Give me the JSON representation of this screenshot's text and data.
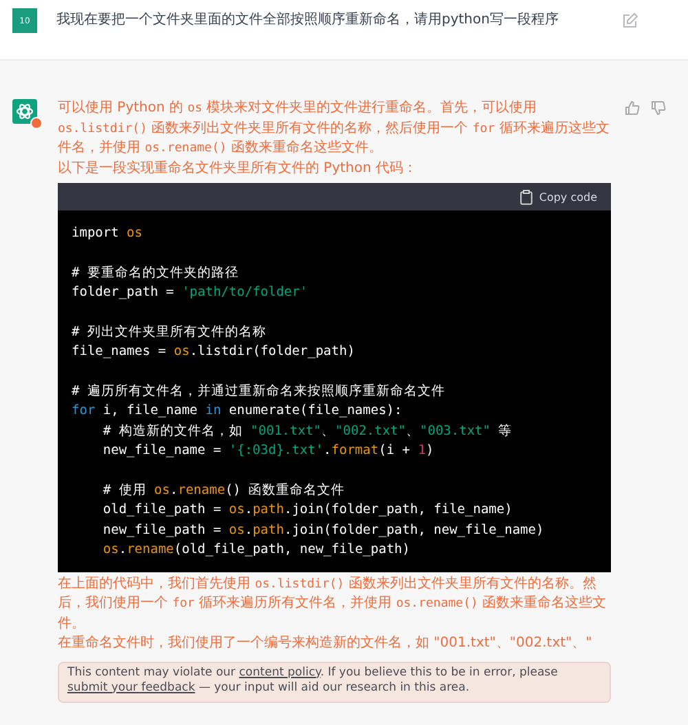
{
  "user_message": {
    "avatar": "10",
    "text": "我现在要把一个文件夹里面的文件全部按照顺序重新命名，请用python写一段程序"
  },
  "assistant_message": {
    "paragraphs": [
      [
        {
          "kind": "text",
          "text": "可以使用 Python 的 "
        },
        {
          "kind": "code",
          "text": "os"
        },
        {
          "kind": "text",
          "text": " 模块来对文件夹里的文件进行重命名。首先，可以使用 "
        },
        {
          "kind": "code",
          "text": "os.listdir()"
        },
        {
          "kind": "text",
          "text": " 函数来列出文件夹里所有文件的名称，然后使用一个 "
        },
        {
          "kind": "code",
          "text": "for"
        },
        {
          "kind": "text",
          "text": " 循环来遍历这些文件名，并使用 "
        },
        {
          "kind": "code",
          "text": "os.rename()"
        },
        {
          "kind": "text",
          "text": " 函数来重命名这些文件。"
        }
      ],
      [
        {
          "kind": "text",
          "text": "以下是一段实现重命名文件夹里所有文件的 Python 代码："
        }
      ]
    ],
    "code_block": {
      "copy_label": "Copy code",
      "blocks": [
        [
          [
            {
              "kind": "plain",
              "text": "import "
            },
            {
              "kind": "builtin",
              "text": "os"
            }
          ]
        ],
        [
          [
            {
              "kind": "comment",
              "text": "# 要重命名的文件夹的路径"
            }
          ],
          [
            {
              "kind": "plain",
              "text": "folder_path = "
            },
            {
              "kind": "string",
              "text": "'path/to/folder'"
            }
          ]
        ],
        [
          [
            {
              "kind": "comment",
              "text": "# 列出文件夹里所有文件的名称"
            }
          ],
          [
            {
              "kind": "plain",
              "text": "file_names = "
            },
            {
              "kind": "builtin",
              "text": "os"
            },
            {
              "kind": "plain",
              "text": ".listdir(folder_path)"
            }
          ]
        ],
        [
          [
            {
              "kind": "comment",
              "text": "# 遍历所有文件名，并通过重新命名来按照顺序重新命名文件"
            }
          ],
          [
            {
              "kind": "keyword",
              "text": "for"
            },
            {
              "kind": "plain",
              "text": " i, file_name "
            },
            {
              "kind": "keyword",
              "text": "in"
            },
            {
              "kind": "plain",
              "text": " enumerate(file_names):"
            }
          ],
          [
            {
              "kind": "comment",
              "text": "    # 构造新的文件名，如 "
            },
            {
              "kind": "string",
              "text": "\"001.txt\""
            },
            {
              "kind": "comment",
              "text": "、"
            },
            {
              "kind": "string",
              "text": "\"002.txt\""
            },
            {
              "kind": "comment",
              "text": "、"
            },
            {
              "kind": "string",
              "text": "\"003.txt\""
            },
            {
              "kind": "comment",
              "text": " 等"
            }
          ],
          [
            {
              "kind": "plain",
              "text": "    new_file_name = "
            },
            {
              "kind": "string",
              "text": "'{:03d}.txt'"
            },
            {
              "kind": "plain",
              "text": "."
            },
            {
              "kind": "builtin",
              "text": "format"
            },
            {
              "kind": "plain",
              "text": "(i + "
            },
            {
              "kind": "number",
              "text": "1"
            },
            {
              "kind": "plain",
              "text": ")"
            }
          ]
        ],
        [
          [
            {
              "kind": "comment",
              "text": "    # 使用 "
            },
            {
              "kind": "builtin",
              "text": "os"
            },
            {
              "kind": "comment",
              "text": "."
            },
            {
              "kind": "builtin",
              "text": "rename"
            },
            {
              "kind": "comment",
              "text": "() 函数重命名文件"
            }
          ],
          [
            {
              "kind": "plain",
              "text": "    old_file_path = "
            },
            {
              "kind": "builtin",
              "text": "os"
            },
            {
              "kind": "plain",
              "text": "."
            },
            {
              "kind": "builtin",
              "text": "path"
            },
            {
              "kind": "plain",
              "text": ".join(folder_path, file_name)"
            }
          ],
          [
            {
              "kind": "plain",
              "text": "    new_file_path = "
            },
            {
              "kind": "builtin",
              "text": "os"
            },
            {
              "kind": "plain",
              "text": "."
            },
            {
              "kind": "builtin",
              "text": "path"
            },
            {
              "kind": "plain",
              "text": ".join(folder_path, new_file_name)"
            }
          ],
          [
            {
              "kind": "builtin",
              "text": "    os"
            },
            {
              "kind": "plain",
              "text": "."
            },
            {
              "kind": "builtin",
              "text": "rename"
            },
            {
              "kind": "plain",
              "text": "(old_file_path, new_file_path)"
            }
          ]
        ]
      ]
    },
    "after_paragraphs": [
      [
        {
          "kind": "text",
          "text": "在上面的代码中，我们首先使用 "
        },
        {
          "kind": "code",
          "text": "os.listdir()"
        },
        {
          "kind": "text",
          "text": " 函数来列出文件夹里所有文件的名称。然后，我们使用一个 "
        },
        {
          "kind": "code",
          "text": "for"
        },
        {
          "kind": "text",
          "text": " 循环来遍历所有文件名，并使用 "
        },
        {
          "kind": "code",
          "text": "os.rename()"
        },
        {
          "kind": "text",
          "text": " 函数来重命名这些文件。"
        }
      ],
      [
        {
          "kind": "text",
          "text": "在重命名文件时，我们使用了一个编号来构造新的文件名，如 \"001.txt\"、\"002.txt\"、\""
        }
      ]
    ]
  },
  "notice": {
    "before": "This content may violate our ",
    "link1": "content policy",
    "middle": ". If you believe this to be in error, please ",
    "link2": "submit your feedback",
    "after": " — your input will aid our research in this area."
  }
}
